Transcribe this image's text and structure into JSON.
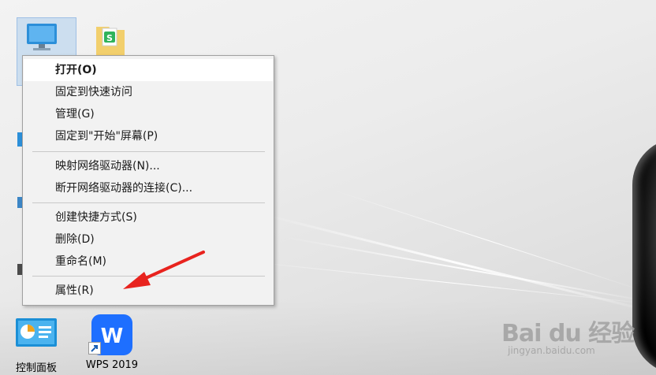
{
  "desktop": {
    "icons": [
      {
        "label": "控制面板"
      },
      {
        "label": "WPS 2019"
      }
    ],
    "wps_glyph": "W"
  },
  "context_menu": {
    "items": [
      {
        "label": "打开(O)"
      },
      {
        "label": "固定到快速访问"
      },
      {
        "label": "管理(G)"
      },
      {
        "label": "固定到\"开始\"屏幕(P)"
      },
      {
        "label": "映射网络驱动器(N)..."
      },
      {
        "label": "断开网络驱动器的连接(C)..."
      },
      {
        "label": "创建快捷方式(S)"
      },
      {
        "label": "删除(D)"
      },
      {
        "label": "重命名(M)"
      },
      {
        "label": "属性(R)"
      }
    ]
  },
  "watermark": {
    "brand": "Bai du 经验",
    "url": "jingyan.baidu.com"
  },
  "colors": {
    "menu_bg": "#f2f2f2",
    "selection": "#adcded",
    "arrow": "#e8231e",
    "wps_blue": "#1e6fff"
  }
}
